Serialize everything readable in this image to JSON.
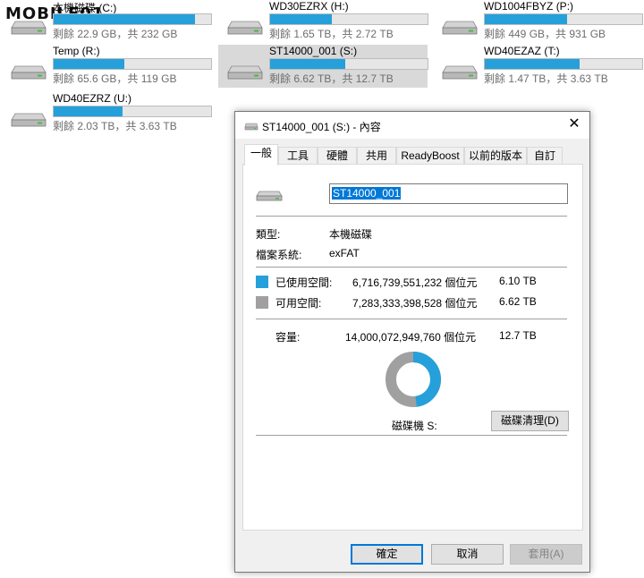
{
  "watermark": "MOBILE01",
  "drives": [
    {
      "name": "本機磁碟 (C:)",
      "free": "22.9 GB",
      "total": "232 GB",
      "used_fraction": 0.9,
      "selected": false
    },
    {
      "name": "WD30EZRX (H:)",
      "free": "1.65 TB",
      "total": "2.72 TB",
      "used_fraction": 0.39,
      "selected": false
    },
    {
      "name": "WD1004FBYZ (P:)",
      "free": "449 GB",
      "total": "931 GB",
      "used_fraction": 0.52,
      "selected": false
    },
    {
      "name": "Temp (R:)",
      "free": "65.6 GB",
      "total": "119 GB",
      "used_fraction": 0.45,
      "selected": false
    },
    {
      "name": "ST14000_001 (S:)",
      "free": "6.62 TB",
      "total": "12.7 TB",
      "used_fraction": 0.48,
      "selected": true
    },
    {
      "name": "WD40EZAZ (T:)",
      "free": "1.47 TB",
      "total": "3.63 TB",
      "used_fraction": 0.6,
      "selected": false
    },
    {
      "name": "WD40EZRZ (U:)",
      "free": "2.03 TB",
      "total": "3.63 TB",
      "used_fraction": 0.44,
      "selected": false
    }
  ],
  "drive_text": {
    "free_prefix": "剩餘 ",
    "total_prefix": "，共 "
  },
  "dialog": {
    "title": "ST14000_001 (S:) - 內容",
    "close_glyph": "✕",
    "tabs": [
      "一般",
      "工具",
      "硬體",
      "共用",
      "ReadyBoost",
      "以前的版本",
      "自訂"
    ],
    "active_tab": "一般",
    "volume_name": "ST14000_001",
    "type_label": "類型:",
    "type_value": "本機磁碟",
    "fs_label": "檔案系統:",
    "fs_value": "exFAT",
    "used_label": "已使用空間:",
    "used_bytes": "6,716,739,551,232 個位元",
    "used_size": "6.10 TB",
    "free_label": "可用空間:",
    "free_bytes": "7,283,333,398,528 個位元",
    "free_size": "6.62 TB",
    "capacity_label": "容量:",
    "capacity_bytes": "14,000,072,949,760 個位元",
    "capacity_size": "12.7 TB",
    "used_fraction": 0.48,
    "drive_label": "磁碟機 S:",
    "cleanup_button": "磁碟清理(D)",
    "ok_button": "確定",
    "cancel_button": "取消",
    "apply_button": "套用(A)"
  },
  "colors": {
    "used": "#26a0da",
    "free": "#a0a0a0",
    "accent": "#0078d7"
  }
}
